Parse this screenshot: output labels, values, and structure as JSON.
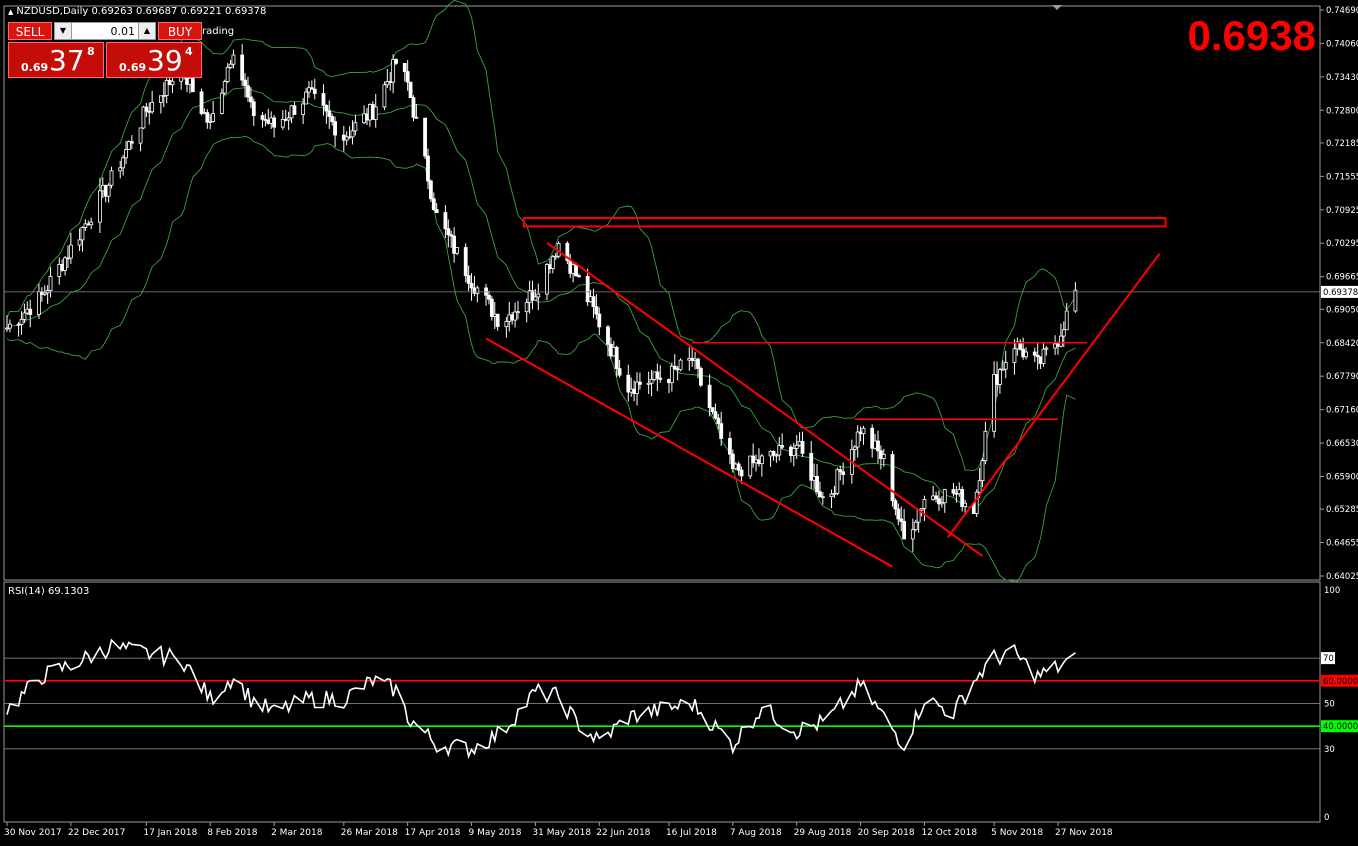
{
  "header": {
    "symbol_text": "NZDUSD,Daily  0.69263 0.69687 0.69221 0.69378",
    "partial_label": "rading",
    "big_price": "0.6938"
  },
  "trade_panel": {
    "sell_label": "SELL",
    "buy_label": "BUY",
    "lot_value": "0.01",
    "sell_price_prefix": "0.69",
    "sell_price_big": "37",
    "sell_price_sup": "8",
    "buy_price_prefix": "0.69",
    "buy_price_big": "39",
    "buy_price_sup": "4"
  },
  "colors": {
    "background": "#000000",
    "candles": "#ffffff",
    "bollinger": "#3aa23a",
    "annotations": "#ff0000",
    "rsi_line": "#ffffff",
    "rsi_upper_level": "#ff0000",
    "rsi_lower_level": "#00ff00",
    "accent_price": "#ff0000"
  },
  "chart_data": [
    {
      "type": "candlestick",
      "title": "",
      "y_ticks": [
        "0.74690",
        "0.74060",
        "0.73430",
        "0.72800",
        "0.72185",
        "0.71555",
        "0.70925",
        "0.70295",
        "0.69665",
        "0.69050",
        "0.68420",
        "0.67790",
        "0.67160",
        "0.66530",
        "0.65900",
        "0.65285",
        "0.64655",
        "0.64025"
      ],
      "current_price_label": "0.69378",
      "ylim": [
        0.64025,
        0.7469
      ],
      "x_tick_labels": [
        "30 Nov 2017",
        "22 Dec 2017",
        "17 Jan 2018",
        "8 Feb 2018",
        "2 Mar 2018",
        "26 Mar 2018",
        "17 Apr 2018",
        "9 May 2018",
        "31 May 2018",
        "22 Jun 2018",
        "16 Jul 2018",
        "7 Aug 2018",
        "29 Aug 2018",
        "20 Sep 2018",
        "12 Oct 2018",
        "5 Nov 2018",
        "27 Nov 2018"
      ],
      "close_path": [
        [
          "30 Nov 2017",
          0.687
        ],
        [
          "12 Dec 2017",
          0.693
        ],
        [
          "22 Dec 2017",
          0.702
        ],
        [
          "5 Jan 2018",
          0.715
        ],
        [
          "17 Jan 2018",
          0.728
        ],
        [
          "29 Jan 2018",
          0.736
        ],
        [
          "8 Feb 2018",
          0.725
        ],
        [
          "16 Feb 2018",
          0.74
        ],
        [
          "22 Feb 2018",
          0.728
        ],
        [
          "2 Mar 2018",
          0.725
        ],
        [
          "14 Mar 2018",
          0.731
        ],
        [
          "26 Mar 2018",
          0.723
        ],
        [
          "5 Apr 2018",
          0.728
        ],
        [
          "13 Apr 2018",
          0.737
        ],
        [
          "17 Apr 2018",
          0.733
        ],
        [
          "27 Apr 2018",
          0.708
        ],
        [
          "9 May 2018",
          0.696
        ],
        [
          "19 May 2018",
          0.688
        ],
        [
          "31 May 2018",
          0.694
        ],
        [
          "8 Jun 2018",
          0.703
        ],
        [
          "14 Jun 2018",
          0.697
        ],
        [
          "22 Jun 2018",
          0.688
        ],
        [
          "2 Jul 2018",
          0.676
        ],
        [
          "16 Jul 2018",
          0.678
        ],
        [
          "24 Jul 2018",
          0.681
        ],
        [
          "7 Aug 2018",
          0.66
        ],
        [
          "17 Aug 2018",
          0.662
        ],
        [
          "29 Aug 2018",
          0.665
        ],
        [
          "8 Sep 2018",
          0.654
        ],
        [
          "20 Sep 2018",
          0.668
        ],
        [
          "28 Sep 2018",
          0.662
        ],
        [
          "5 Oct 2018",
          0.647
        ],
        [
          "12 Oct 2018",
          0.655
        ],
        [
          "22 Oct 2018",
          0.656
        ],
        [
          "29 Oct 2018",
          0.653
        ],
        [
          "5 Nov 2018",
          0.677
        ],
        [
          "12 Nov 2018",
          0.684
        ],
        [
          "20 Nov 2018",
          0.68
        ],
        [
          "27 Nov 2018",
          0.685
        ],
        [
          "3 Dec 2018",
          0.6938
        ]
      ],
      "indicators": [
        "Bollinger Bands"
      ],
      "annotations": [
        "resistance zone near 0.7070",
        "descending channel May-Oct 2018",
        "horizontal level near 0.6842",
        "horizontal level near 0.6700",
        "rising trendline from Oct 2018 low"
      ]
    },
    {
      "type": "line",
      "title": "RSI(14) 69.1303",
      "ylim": [
        0,
        100
      ],
      "y_ticks": [
        "100",
        "70",
        "60.0000",
        "50",
        "40.0000",
        "30",
        "0"
      ],
      "levels": [
        70,
        60,
        50,
        40,
        30
      ],
      "rsi_path": [
        [
          "30 Nov 2017",
          47
        ],
        [
          "12 Dec 2017",
          62
        ],
        [
          "22 Dec 2017",
          67
        ],
        [
          "5 Jan 2018",
          75
        ],
        [
          "17 Jan 2018",
          72
        ],
        [
          "29 Jan 2018",
          70
        ],
        [
          "8 Feb 2018",
          52
        ],
        [
          "16 Feb 2018",
          62
        ],
        [
          "22 Feb 2018",
          52
        ],
        [
          "2 Mar 2018",
          46
        ],
        [
          "14 Mar 2018",
          52
        ],
        [
          "26 Mar 2018",
          52
        ],
        [
          "5 Apr 2018",
          60
        ],
        [
          "13 Apr 2018",
          56
        ],
        [
          "17 Apr 2018",
          44
        ],
        [
          "27 Apr 2018",
          32
        ],
        [
          "9 May 2018",
          30
        ],
        [
          "19 May 2018",
          37
        ],
        [
          "31 May 2018",
          55
        ],
        [
          "8 Jun 2018",
          53
        ],
        [
          "14 Jun 2018",
          42
        ],
        [
          "22 Jun 2018",
          33
        ],
        [
          "2 Jul 2018",
          44
        ],
        [
          "16 Jul 2018",
          48
        ],
        [
          "24 Jul 2018",
          50
        ],
        [
          "7 Aug 2018",
          32
        ],
        [
          "17 Aug 2018",
          48
        ],
        [
          "29 Aug 2018",
          38
        ],
        [
          "8 Sep 2018",
          42
        ],
        [
          "20 Sep 2018",
          58
        ],
        [
          "28 Sep 2018",
          44
        ],
        [
          "5 Oct 2018",
          32
        ],
        [
          "12 Oct 2018",
          52
        ],
        [
          "22 Oct 2018",
          46
        ],
        [
          "29 Oct 2018",
          60
        ],
        [
          "5 Nov 2018",
          70
        ],
        [
          "12 Nov 2018",
          72
        ],
        [
          "20 Nov 2018",
          62
        ],
        [
          "27 Nov 2018",
          66
        ],
        [
          "3 Dec 2018",
          69
        ]
      ]
    }
  ]
}
